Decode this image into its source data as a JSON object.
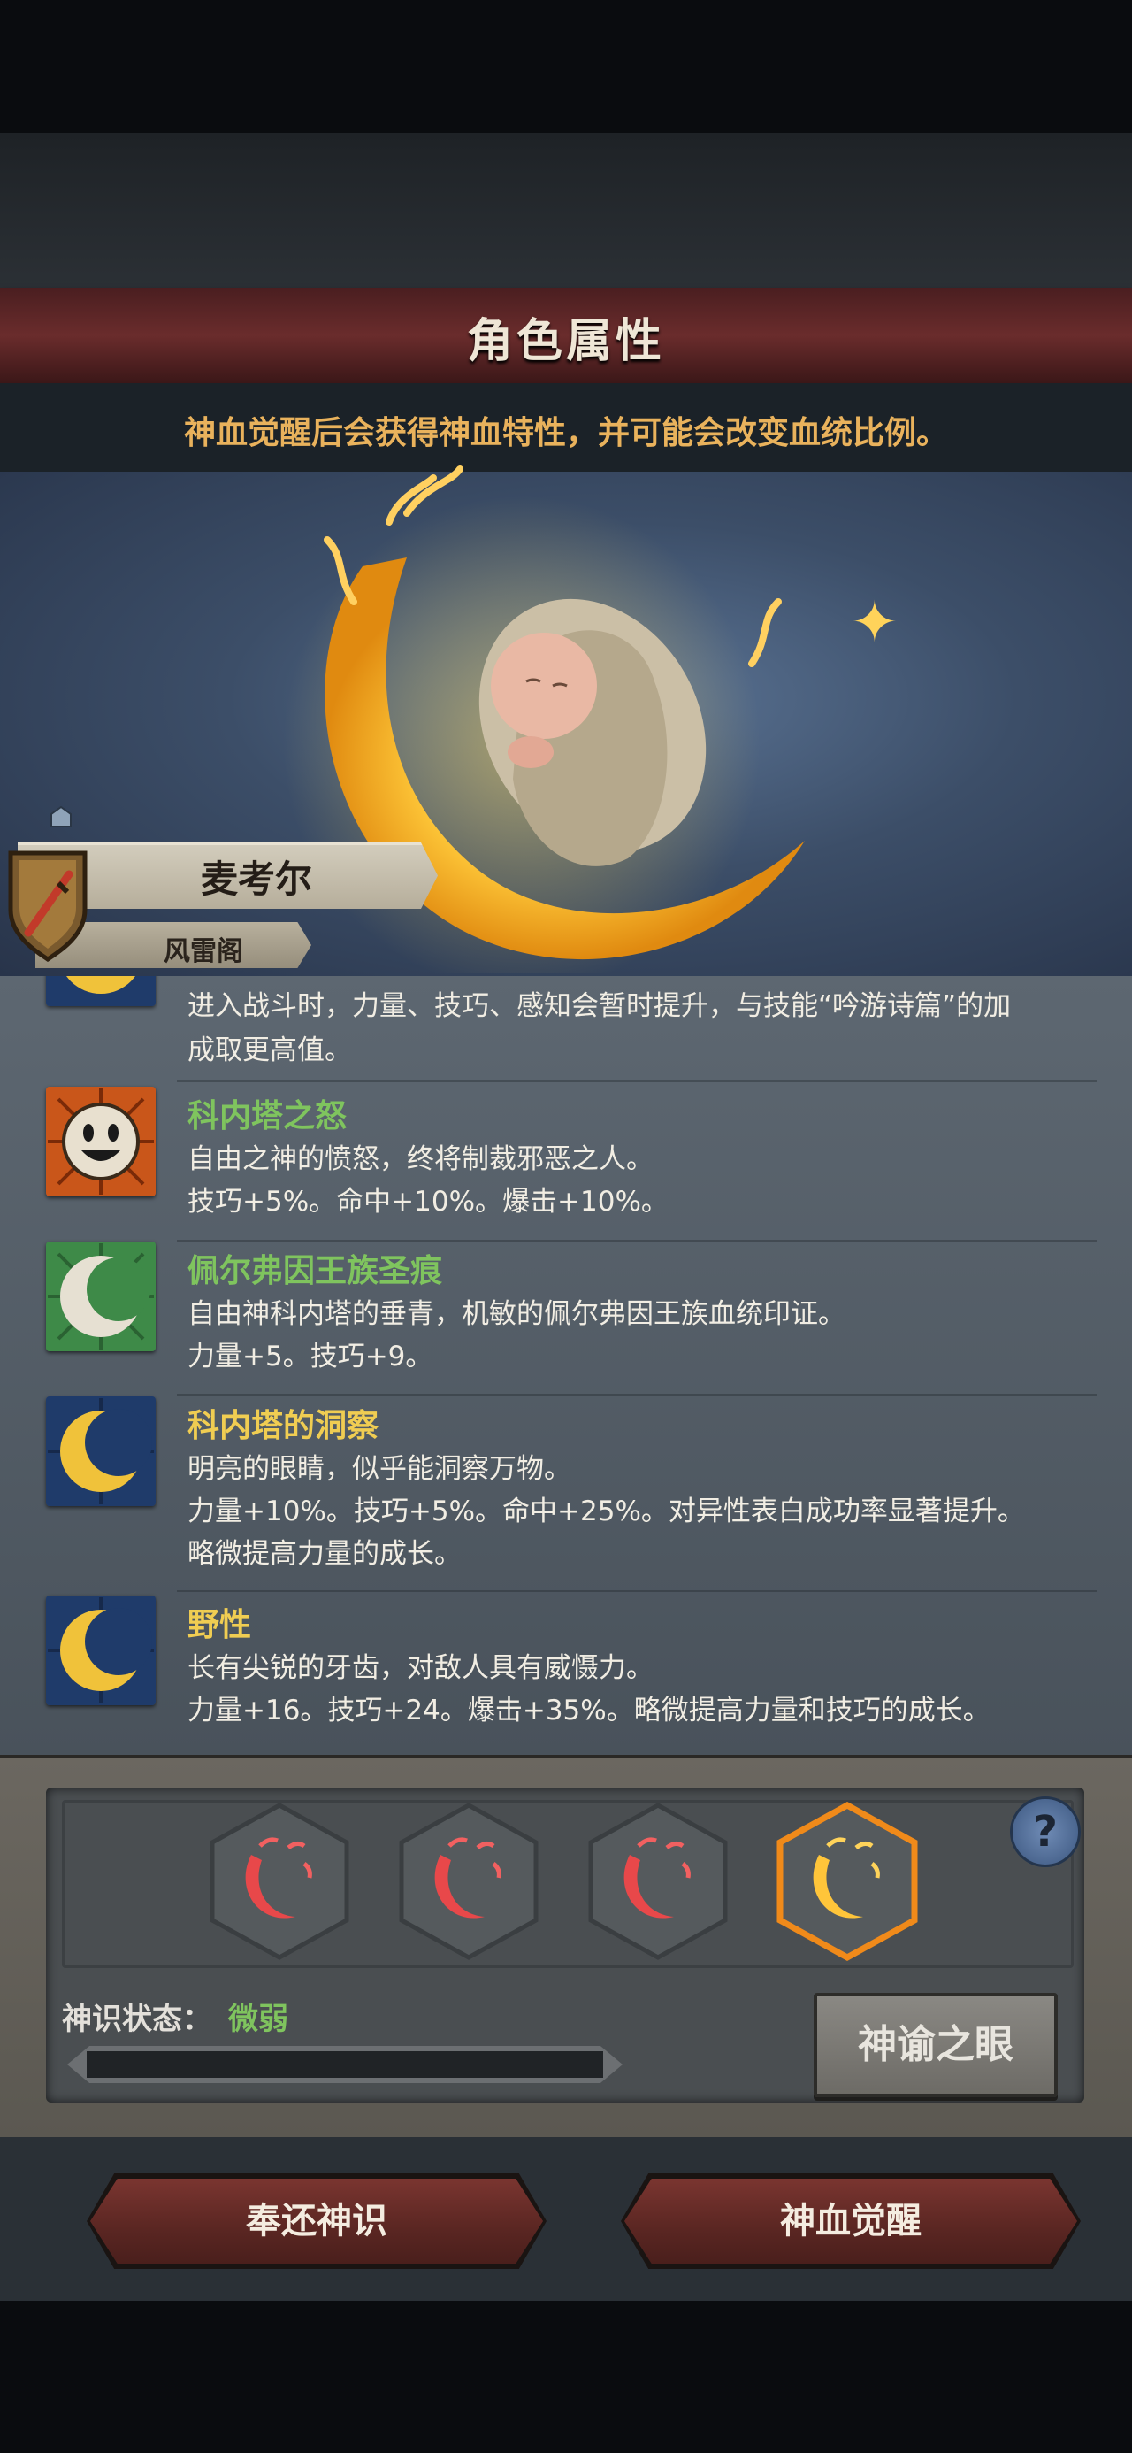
{
  "header": {
    "title": "角色属性"
  },
  "hint": "神血觉醒后会获得神血特性，并可能会改变血统比例。",
  "character": {
    "name": "麦考尔",
    "faction": "风雷阁"
  },
  "traits": [
    {
      "name": "",
      "icon": "golden-moon-icon",
      "lines": [
        "进入战斗时，力量、技巧、感知会暂时提升，与技能“吟游诗篇”的加",
        "成取更高值。"
      ]
    },
    {
      "name": "科内塔之怒",
      "name_color": "#7fc45e",
      "icon": "grinning-sun-face-icon",
      "lines": [
        "自由之神的愤怒，终将制裁邪恶之人。",
        "技巧+5%。命中+10%。爆击+10%。"
      ]
    },
    {
      "name": "佩尔弗因王族圣痕",
      "name_color": "#7fc45e",
      "icon": "white-crescent-icon",
      "lines": [
        "自由神科内塔的垂青，机敏的佩尔弗因王族血统印证。",
        "力量+5。技巧+9。"
      ]
    },
    {
      "name": "科内塔的洞察",
      "name_color": "#f0cd52",
      "icon": "golden-moon-icon",
      "lines": [
        "明亮的眼睛，似乎能洞察万物。",
        "力量+10%。技巧+5%。命中+25%。对异性表白成功率显著提升。",
        "略微提高力量的成长。"
      ]
    },
    {
      "name": "野性",
      "name_color": "#f0cd52",
      "icon": "golden-moon-icon",
      "lines": [
        "长有尖锐的牙齿，对敌人具有威慑力。",
        "力量+16。技巧+24。爆击+35%。略微提高力量和技巧的成长。"
      ]
    }
  ],
  "awakening": {
    "slots": [
      {
        "state": "red",
        "icon": "red-crescent-icon"
      },
      {
        "state": "red",
        "icon": "red-crescent-icon"
      },
      {
        "state": "red",
        "icon": "red-crescent-icon"
      },
      {
        "state": "gold",
        "icon": "gold-crescent-icon"
      }
    ],
    "help_label": "?",
    "status_label": "神识状态：",
    "status_value": "微弱",
    "progress": 0,
    "oracle_button": "神谕之眼"
  },
  "buttons": {
    "return": "奉还神识",
    "awaken": "神血觉醒"
  },
  "colors": {
    "accent_gold": "#e9b25c",
    "positive_green": "#7fc45e",
    "banner_red": "#6a2c2c"
  }
}
